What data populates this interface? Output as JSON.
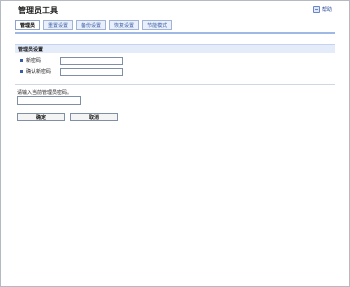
{
  "header": {
    "title": "管理员工具",
    "help_label": "帮助"
  },
  "tabs": [
    {
      "label": "管理员",
      "active": true
    },
    {
      "label": "重置设置",
      "active": false
    },
    {
      "label": "备份设置",
      "active": false
    },
    {
      "label": "恢复设置",
      "active": false
    },
    {
      "label": "节能模式",
      "active": false
    }
  ],
  "admin_settings": {
    "heading": "管理员设置",
    "new_password_label": "新密码",
    "confirm_password_label": "确认新密码",
    "new_password_value": "",
    "confirm_password_value": ""
  },
  "current_password": {
    "prompt": "请输入当前管理员密码。",
    "value": ""
  },
  "buttons": {
    "ok": "确定",
    "cancel": "取消"
  },
  "colors": {
    "accent": "#3a5ca6",
    "tab_bg": "#e9f0fb",
    "section_bg": "#e4ecfa"
  }
}
